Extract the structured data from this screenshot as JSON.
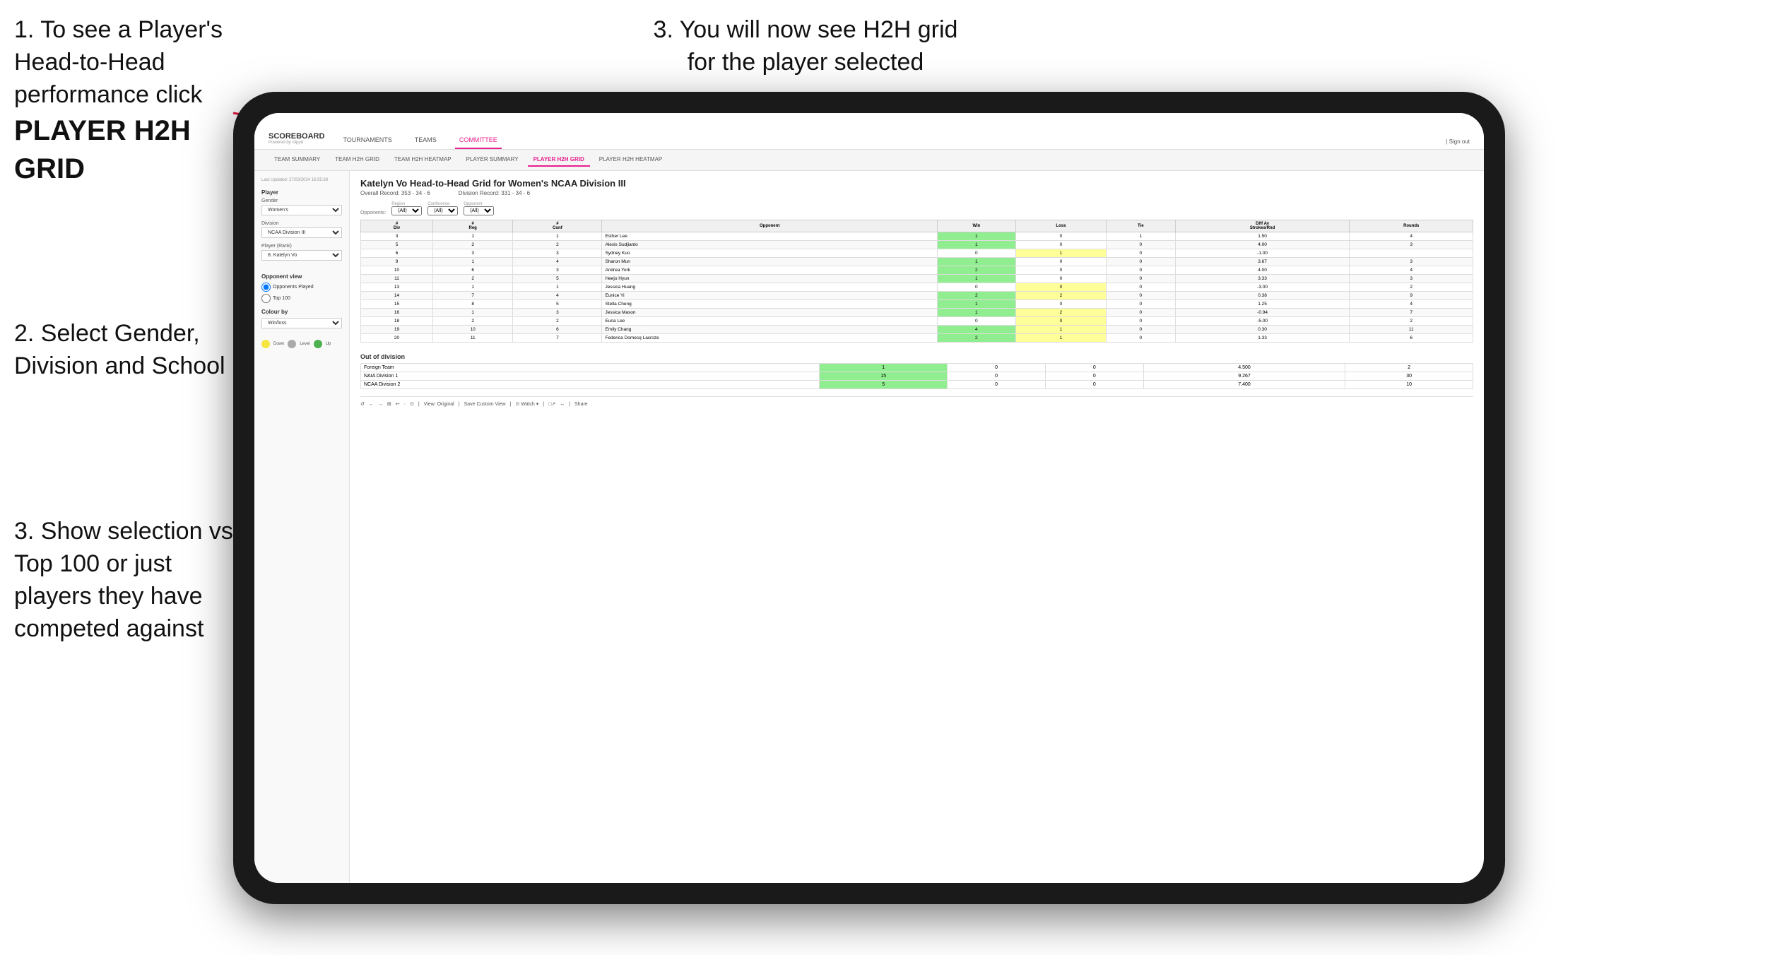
{
  "instructions": {
    "step1": "1. To see a Player's Head-to-Head performance click",
    "step1_bold": "PLAYER H2H GRID",
    "step2": "2. Select Gender, Division and School",
    "step3_top": "3. You will now see H2H grid for the player selected",
    "step3_bottom": "3. Show selection vs Top 100 or just players they have competed against"
  },
  "navbar": {
    "logo": "SCOREBOARD",
    "logo_sub": "Powered by clippd",
    "nav_items": [
      "TOURNAMENTS",
      "TEAMS",
      "COMMITTEE"
    ],
    "sign_out": "| Sign out"
  },
  "subnav": {
    "items": [
      "TEAM SUMMARY",
      "TEAM H2H GRID",
      "TEAM H2H HEATMAP",
      "PLAYER SUMMARY",
      "PLAYER H2H GRID",
      "PLAYER H2H HEATMAP"
    ]
  },
  "sidebar": {
    "timestamp": "Last Updated: 27/03/2024 16:55:38",
    "player_label": "Player",
    "gender_label": "Gender",
    "gender_value": "Women's",
    "division_label": "Division",
    "division_value": "NCAA Division III",
    "player_rank_label": "Player (Rank)",
    "player_rank_value": "8. Katelyn Vo",
    "opponent_view_label": "Opponent view",
    "opponent_options": [
      "Opponents Played",
      "Top 100"
    ],
    "colour_by_label": "Colour by",
    "colour_by_value": "Win/loss",
    "legend": [
      {
        "color": "#f5e642",
        "label": "Down"
      },
      {
        "color": "#aaaaaa",
        "label": "Level"
      },
      {
        "color": "#4caf50",
        "label": "Up"
      }
    ]
  },
  "content": {
    "title": "Katelyn Vo Head-to-Head Grid for Women's NCAA Division III",
    "overall_record": "Overall Record: 353 - 34 - 6",
    "division_record": "Division Record: 331 - 34 - 6",
    "filters": {
      "opponents_label": "Opponents:",
      "region_label": "Region",
      "region_value": "(All)",
      "conference_label": "Conference",
      "conference_value": "(All)",
      "opponent_label": "Opponent",
      "opponent_value": "(All)"
    },
    "table_headers": [
      "#\nDiv",
      "#\nReg",
      "#\nConf",
      "Opponent",
      "Win",
      "Loss",
      "Tie",
      "Diff Av\nStrokes/Rnd",
      "Rounds"
    ],
    "rows": [
      {
        "div": 3,
        "reg": 1,
        "conf": 1,
        "opponent": "Esther Lee",
        "win": 1,
        "loss": 0,
        "tie": 1,
        "diff": "1.50",
        "rounds": 4,
        "win_color": "green",
        "loss_color": "white",
        "tie_color": "light-green"
      },
      {
        "div": 5,
        "reg": 2,
        "conf": 2,
        "opponent": "Alexis Sudjianto",
        "win": 1,
        "loss": 0,
        "tie": 0,
        "diff": "4.00",
        "rounds": 3,
        "win_color": "green",
        "loss_color": "white",
        "tie_color": "white"
      },
      {
        "div": 6,
        "reg": 3,
        "conf": 3,
        "opponent": "Sydney Kuo",
        "win": 0,
        "loss": 1,
        "tie": 0,
        "diff": "-1.00",
        "rounds": "",
        "win_color": "white",
        "loss_color": "yellow",
        "tie_color": "white"
      },
      {
        "div": 9,
        "reg": 1,
        "conf": 4,
        "opponent": "Sharon Mun",
        "win": 1,
        "loss": 0,
        "tie": 0,
        "diff": "3.67",
        "rounds": 3,
        "win_color": "green",
        "loss_color": "white",
        "tie_color": "white"
      },
      {
        "div": 10,
        "reg": 6,
        "conf": 3,
        "opponent": "Andrea York",
        "win": 2,
        "loss": 0,
        "tie": 0,
        "diff": "4.00",
        "rounds": 4,
        "win_color": "green",
        "loss_color": "white",
        "tie_color": "white"
      },
      {
        "div": 11,
        "reg": 2,
        "conf": 5,
        "opponent": "Heejo Hyun",
        "win": 1,
        "loss": 0,
        "tie": 0,
        "diff": "3.33",
        "rounds": 3,
        "win_color": "green",
        "loss_color": "white",
        "tie_color": "white"
      },
      {
        "div": 13,
        "reg": 1,
        "conf": 1,
        "opponent": "Jessica Huang",
        "win": 0,
        "loss": 0,
        "tie": 0,
        "diff": "-3.00",
        "rounds": 2,
        "win_color": "white",
        "loss_color": "yellow",
        "tie_color": "white"
      },
      {
        "div": 14,
        "reg": 7,
        "conf": 4,
        "opponent": "Eunice Yi",
        "win": 2,
        "loss": 2,
        "tie": 0,
        "diff": "0.38",
        "rounds": 9,
        "win_color": "green",
        "loss_color": "yellow",
        "tie_color": "white"
      },
      {
        "div": 15,
        "reg": 8,
        "conf": 5,
        "opponent": "Stella Cheng",
        "win": 1,
        "loss": 0,
        "tie": 0,
        "diff": "1.25",
        "rounds": 4,
        "win_color": "green",
        "loss_color": "white",
        "tie_color": "white"
      },
      {
        "div": 16,
        "reg": 1,
        "conf": 3,
        "opponent": "Jessica Mason",
        "win": 1,
        "loss": 2,
        "tie": 0,
        "diff": "-0.94",
        "rounds": 7,
        "win_color": "green",
        "loss_color": "yellow",
        "tie_color": "white"
      },
      {
        "div": 18,
        "reg": 2,
        "conf": 2,
        "opponent": "Euna Lee",
        "win": 0,
        "loss": 0,
        "tie": 0,
        "diff": "-5.00",
        "rounds": 2,
        "win_color": "white",
        "loss_color": "yellow",
        "tie_color": "white"
      },
      {
        "div": 19,
        "reg": 10,
        "conf": 6,
        "opponent": "Emily Chang",
        "win": 4,
        "loss": 1,
        "tie": 0,
        "diff": "0.30",
        "rounds": 11,
        "win_color": "green",
        "loss_color": "yellow",
        "tie_color": "white"
      },
      {
        "div": 20,
        "reg": 11,
        "conf": 7,
        "opponent": "Federica Domecq Lacroze",
        "win": 2,
        "loss": 1,
        "tie": 0,
        "diff": "1.33",
        "rounds": 6,
        "win_color": "green",
        "loss_color": "yellow",
        "tie_color": "white"
      }
    ],
    "out_of_division_label": "Out of division",
    "out_of_division_rows": [
      {
        "name": "Foreign Team",
        "win": 1,
        "loss": 0,
        "tie": 0,
        "diff": "4.500",
        "rounds": 2,
        "win_color": "green"
      },
      {
        "name": "NAIA Division 1",
        "win": 15,
        "loss": 0,
        "tie": 0,
        "diff": "9.267",
        "rounds": 30,
        "win_color": "green"
      },
      {
        "name": "NCAA Division 2",
        "win": 5,
        "loss": 0,
        "tie": 0,
        "diff": "7.400",
        "rounds": 10,
        "win_color": "green"
      }
    ]
  },
  "toolbar": {
    "items": [
      "↺",
      "←",
      "→",
      "⊞",
      "↩",
      "·",
      "⊙",
      "View: Original",
      "Save Custom View",
      "⊙ Watch ▾",
      "□↗",
      "↔",
      "Share"
    ]
  }
}
